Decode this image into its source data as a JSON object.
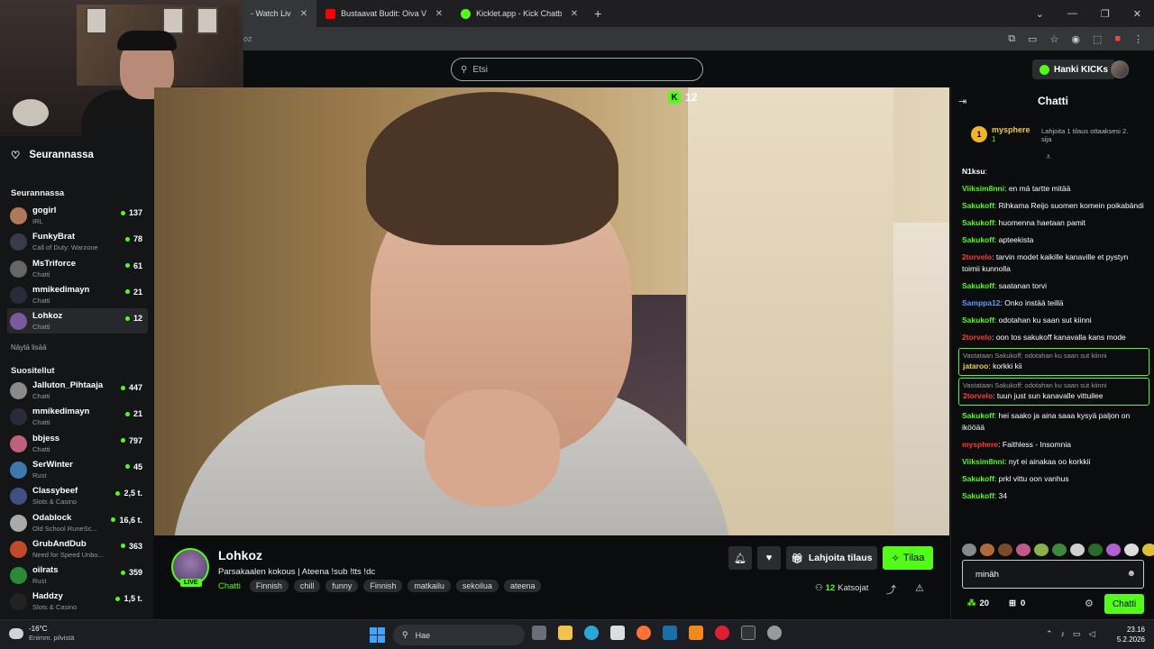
{
  "browser": {
    "tabs": [
      {
        "label": "- Watch Liv",
        "color": "#53fc18"
      },
      {
        "label": "Bustaavat Budit: Oiva Vedätys, N",
        "color": "#ff0000"
      },
      {
        "label": "Kicklet.app - Kick Chatbot and C",
        "color": "#53fc18"
      }
    ],
    "address_text": "oz"
  },
  "header": {
    "search_placeholder": "Etsi",
    "kicks_button": "Hanki KICKs"
  },
  "sidebar": {
    "following_title": "Seurannassa",
    "section_following": "Seurannassa",
    "show_more": "Näytä lisää",
    "section_recommended": "Suositellut",
    "following": [
      {
        "name": "gogirl",
        "sub": "IRL",
        "count": "137",
        "color": "#b07a5a"
      },
      {
        "name": "FunkyBrat",
        "sub": "Call of Duty: Warzone",
        "count": "78",
        "color": "#3a3a4a"
      },
      {
        "name": "MsTriforce",
        "sub": "Chatti",
        "count": "61",
        "color": "#666"
      },
      {
        "name": "mmikedimayn",
        "sub": "Chatti",
        "count": "21",
        "color": "#2a2a3a"
      },
      {
        "name": "Lohkoz",
        "sub": "Chatti",
        "count": "12",
        "color": "#7a5a9a"
      }
    ],
    "recommended": [
      {
        "name": "Jalluton_Pihtaaja",
        "sub": "Chatti",
        "count": "447",
        "color": "#8a8a8a"
      },
      {
        "name": "mmikedimayn",
        "sub": "Chatti",
        "count": "21",
        "color": "#2a2a3a"
      },
      {
        "name": "bbjess",
        "sub": "Chatti",
        "count": "797",
        "color": "#c0607a"
      },
      {
        "name": "SerWinter",
        "sub": "Rust",
        "count": "45",
        "color": "#3a7ab0"
      },
      {
        "name": "Classybeef",
        "sub": "Slots & Casino",
        "count": "2,5 t.",
        "color": "#405080"
      },
      {
        "name": "Odablock",
        "sub": "Old School RuneSc...",
        "count": "16,6 t.",
        "color": "#aaa"
      },
      {
        "name": "GrubAndDub",
        "sub": "Need for Speed Unbo...",
        "count": "363",
        "color": "#c04a2a"
      },
      {
        "name": "oilrats",
        "sub": "Rust",
        "count": "359",
        "color": "#2a8a3a"
      },
      {
        "name": "Haddzy",
        "sub": "Slots & Casino",
        "count": "1,5 t.",
        "color": "#222"
      }
    ]
  },
  "video": {
    "viewer_count": "12"
  },
  "stream": {
    "channel": "Lohkoz",
    "live": "LIVE",
    "title": "Parsakaalen kokous | Ateena !sub !tts !dc",
    "category": "Chatti",
    "tags": [
      "Finnish",
      "chill",
      "funny",
      "Finnish",
      "matkailu",
      "sekoilua",
      "ateena"
    ],
    "gift_button": "Lahjoita tilaus",
    "subscribe_button": "Tilaa",
    "viewers_count": "12",
    "viewers_label": "Katsojat"
  },
  "chat": {
    "title": "Chatti",
    "pinned": {
      "rank": "1",
      "name": "mysphere",
      "count": "1",
      "hint": "Lahjoita 1 tilaus ottaaksesi 2. sija"
    },
    "messages": [
      {
        "user": "N1ksu",
        "text": "",
        "color": "#ffffff",
        "reply": ""
      },
      {
        "user": "Viiksim8nni",
        "text": "en mä tartte mitää",
        "color": "#53fc18",
        "reply": ""
      },
      {
        "user": "Sakukoff",
        "text": "Rihkama Reijo suomen komein poikabändi",
        "color": "#53fc18",
        "reply": ""
      },
      {
        "user": "Sakukoff",
        "text": "huomenna haetaan pamit",
        "color": "#53fc18",
        "reply": ""
      },
      {
        "user": "Sakukoff",
        "text": "apteekista",
        "color": "#53fc18",
        "reply": ""
      },
      {
        "user": "2torvelo",
        "text": "tarvin modet kaikille kanaville et pystyn toimii kunnolla",
        "color": "#ff3b3b",
        "reply": ""
      },
      {
        "user": "Sakukoff",
        "text": "saatanan torvi",
        "color": "#53fc18",
        "reply": ""
      },
      {
        "user": "Samppa12",
        "text": "Onko instää teillä",
        "color": "#5a9cff",
        "reply": ""
      },
      {
        "user": "Sakukoff",
        "text": "odotahan ku saan sut kiinni",
        "color": "#53fc18",
        "reply": ""
      },
      {
        "user": "2torvelo",
        "text": "oon tos sakukoff kanavalla kans mode",
        "color": "#ff3b3b",
        "reply": ""
      },
      {
        "user": "jataroo",
        "text": "korkki kii",
        "color": "#f0c94a",
        "reply": "Vastataan Sakukoff: odotahan ku saan sut kiinni"
      },
      {
        "user": "2torvelo",
        "text": "tuun just sun kanavalle vittuilee",
        "color": "#ff3b3b",
        "reply": "Vastataan Sakukoff: odotahan ku saan sut kiinni"
      },
      {
        "user": "Sakukoff",
        "text": "hei saako ja aina saaa kysyä paljon on ikööää",
        "color": "#53fc18",
        "reply": ""
      },
      {
        "user": "mysphere",
        "text": "Faithless - Insomnia",
        "color": "#ff3b3b",
        "reply": ""
      },
      {
        "user": "Viiksim8nni",
        "text": "nyt ei ainakaa oo korkkii",
        "color": "#53fc18",
        "reply": ""
      },
      {
        "user": "Sakukoff",
        "text": "prkl vittu oon vanhus",
        "color": "#53fc18",
        "reply": ""
      },
      {
        "user": "Sakukoff",
        "text": "34",
        "color": "#53fc18",
        "reply": ""
      }
    ],
    "input_value": "minäh",
    "points": "20",
    "gifts": "0",
    "send_button": "Chatti"
  },
  "taskbar": {
    "temperature": "-16°C",
    "weather_desc": "Enimm. pilvistä",
    "search_placeholder": "Hae",
    "time": "23.16",
    "date": "5.2.2026"
  }
}
